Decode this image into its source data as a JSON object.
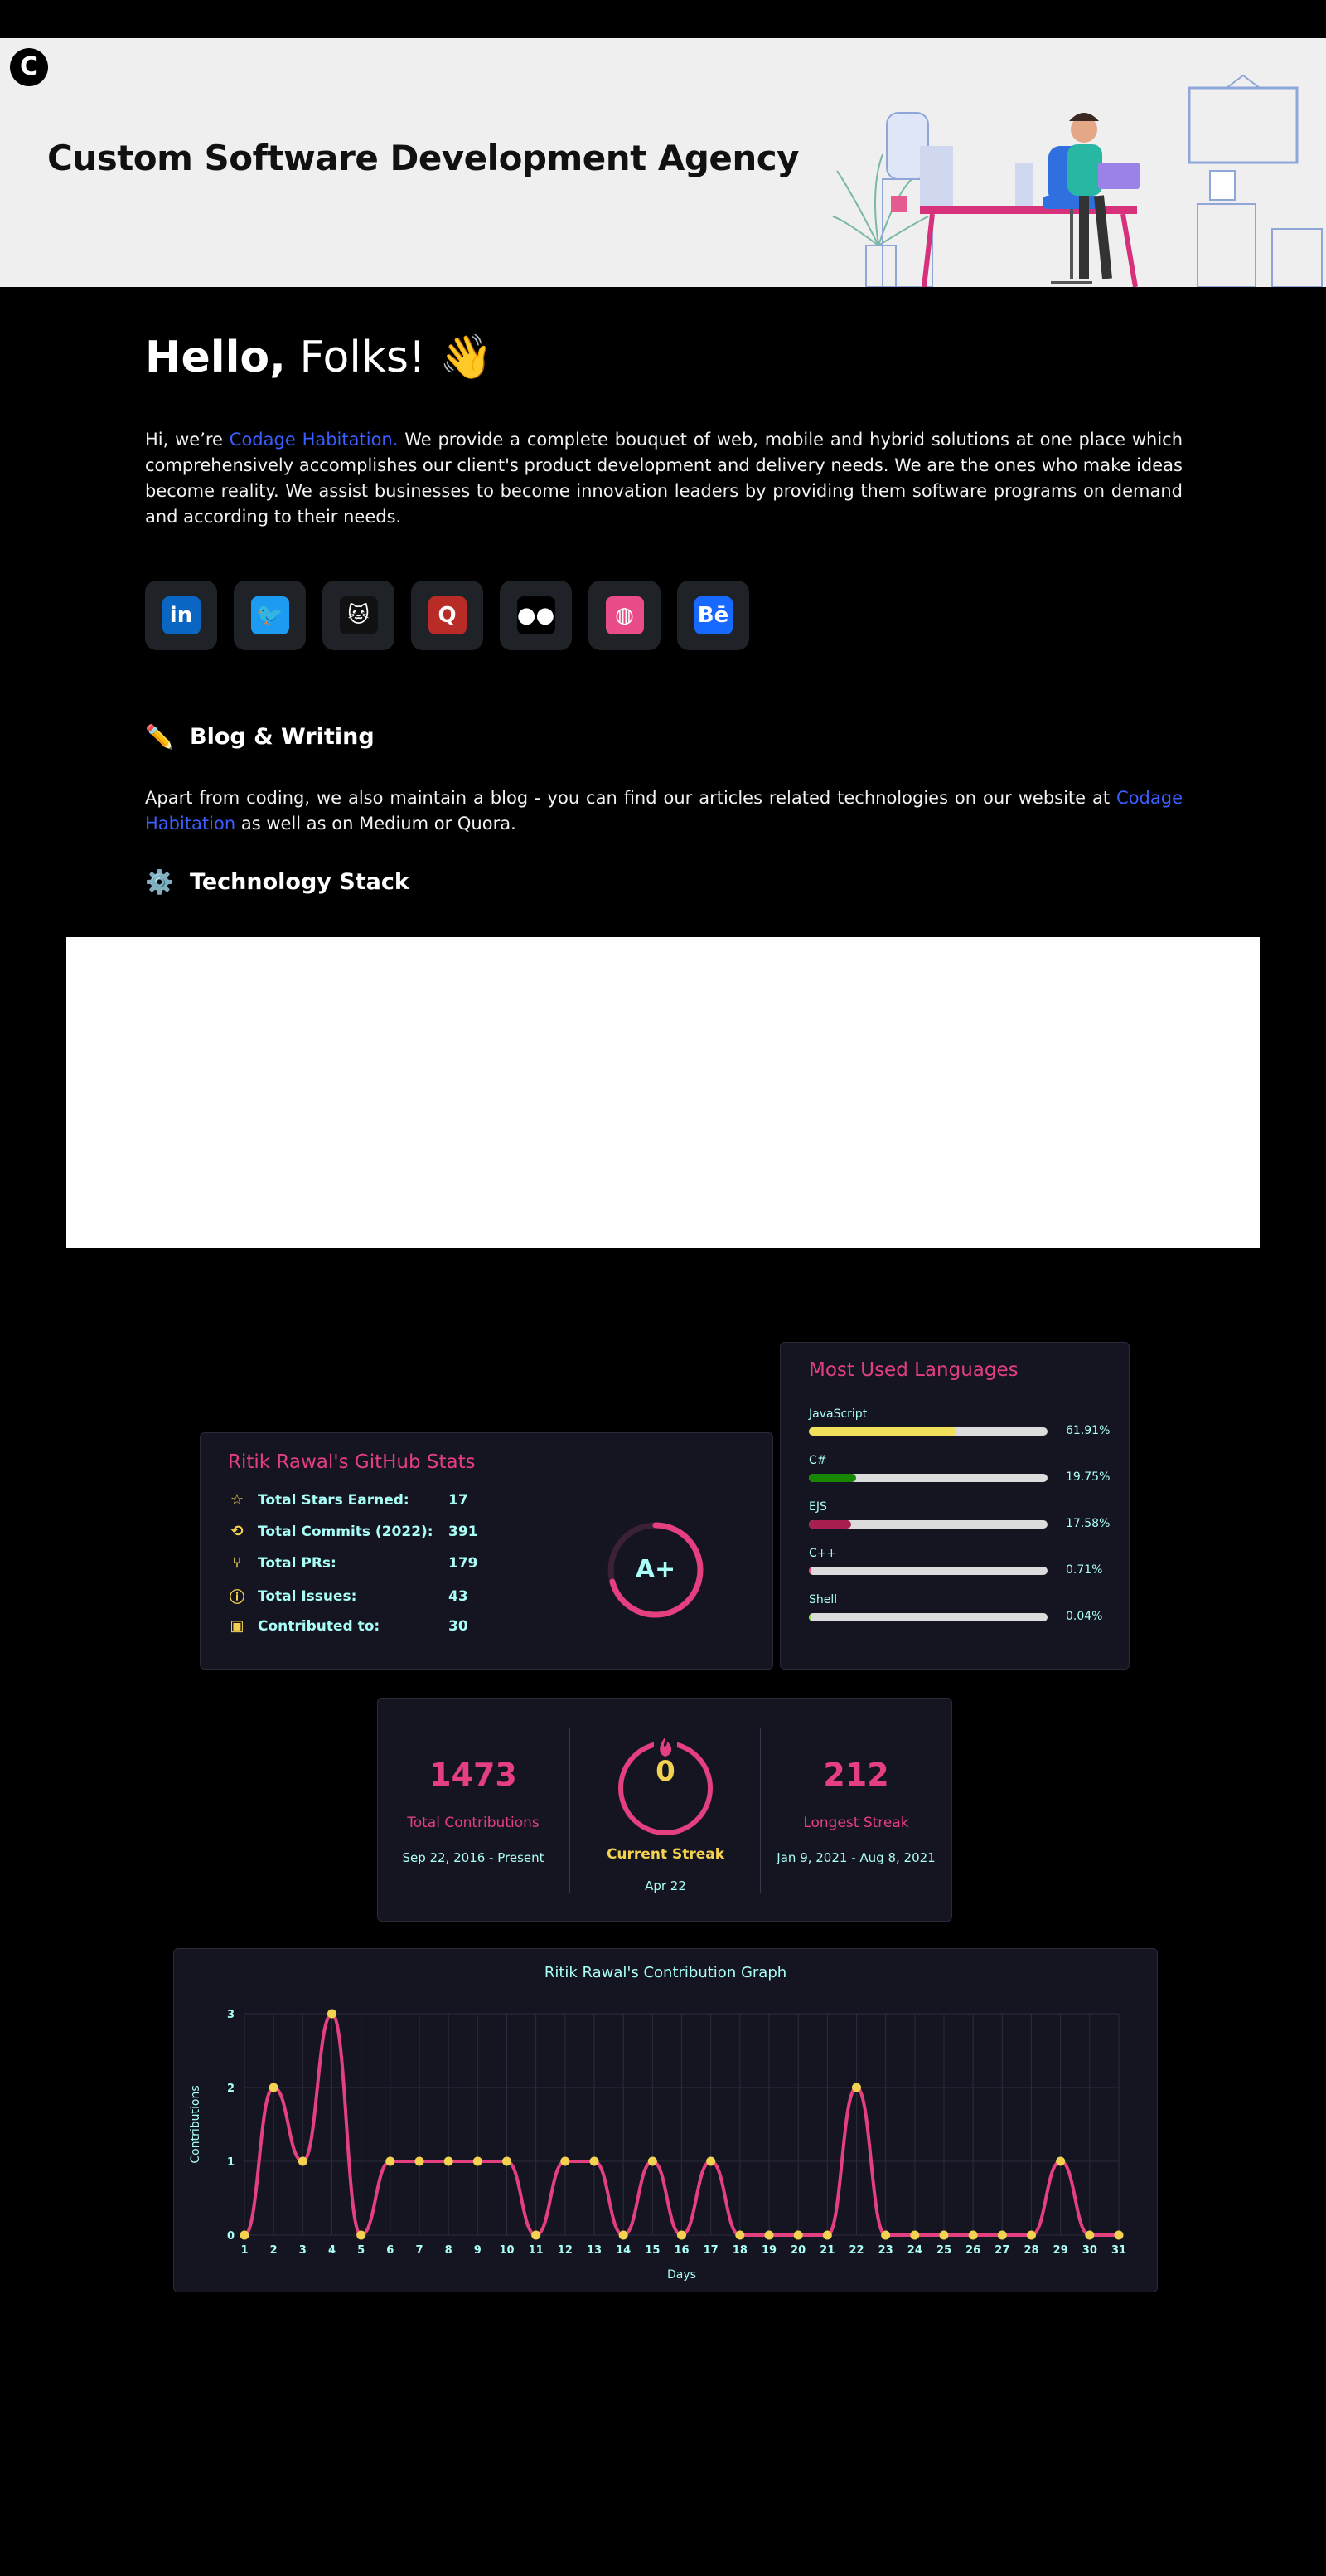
{
  "banner": {
    "logo_glyph": "C",
    "title": "Custom Software Development Agency"
  },
  "intro": {
    "hello_bold": "Hello,",
    "hello_rest": " Folks! 👋",
    "text_before": "Hi, we’re ",
    "company_link": "Codage Habitation.",
    "text_after": " We provide a complete bouquet of web, mobile and hybrid solutions at one place which comprehensively accomplishes our client's product development and delivery needs. We are the ones who make ideas become reality. We assist businesses to become innovation leaders by providing them software programs on demand and according to their needs."
  },
  "socials": [
    {
      "name": "linkedin-icon",
      "glyph": "in",
      "color": "#0a66c2"
    },
    {
      "name": "twitter-icon",
      "glyph": "🐦",
      "color": "#1d9bf0"
    },
    {
      "name": "github-icon",
      "glyph": "🐱",
      "color": "#111111"
    },
    {
      "name": "quora-icon",
      "glyph": "Q",
      "color": "#b92b27"
    },
    {
      "name": "medium-icon",
      "glyph": "●●",
      "color": "#000000"
    },
    {
      "name": "dribbble-icon",
      "glyph": "◍",
      "color": "#ea4c89"
    },
    {
      "name": "behance-icon",
      "glyph": "Bē",
      "color": "#1769ff"
    }
  ],
  "blog": {
    "icon": "✏️",
    "heading": "Blog & Writing",
    "text_before": "Apart from coding, we also maintain a blog - you can find our articles related technologies on our website at ",
    "link": "Codage Habitation",
    "text_after": " as well as on Medium or Quora."
  },
  "tech": {
    "icon": "⚙️",
    "heading": "Technology Stack"
  },
  "github_stats": {
    "title": "Ritik Rawal's GitHub Stats",
    "grade": "A+",
    "rows": [
      {
        "icon": "☆",
        "label": "Total Stars Earned:",
        "value": "17"
      },
      {
        "icon": "⟲",
        "label": "Total Commits (2022):",
        "value": "391"
      },
      {
        "icon": "⑂",
        "label": "Total PRs:",
        "value": "179"
      },
      {
        "icon": "ⓘ",
        "label": "Total Issues:",
        "value": "43"
      },
      {
        "icon": "▣",
        "label": "Contributed to:",
        "value": "30"
      }
    ]
  },
  "languages": {
    "title": "Most Used Languages",
    "items": [
      {
        "name": "JavaScript",
        "percent": "61.91%",
        "fraction": 0.6191,
        "color": "#f1e05a"
      },
      {
        "name": "C#",
        "percent": "19.75%",
        "fraction": 0.1975,
        "color": "#178600"
      },
      {
        "name": "EJS",
        "percent": "17.58%",
        "fraction": 0.1758,
        "color": "#a91e50"
      },
      {
        "name": "C++",
        "percent": "0.71%",
        "fraction": 0.0071,
        "color": "#f34b7d"
      },
      {
        "name": "Shell",
        "percent": "0.04%",
        "fraction": 0.0004,
        "color": "#89e051"
      }
    ]
  },
  "streak": {
    "total": "1473",
    "total_label": "Total Contributions",
    "total_range": "Sep 22, 2016 - Present",
    "current": "0",
    "current_label": "Current Streak",
    "current_date": "Apr 22",
    "longest": "212",
    "longest_label": "Longest Streak",
    "longest_range": "Jan 9, 2021 - Aug 8, 2021"
  },
  "chart_data": {
    "type": "line",
    "title": "Ritik Rawal's Contribution Graph",
    "xlabel": "Days",
    "ylabel": "Contributions",
    "x": [
      1,
      2,
      3,
      4,
      5,
      6,
      7,
      8,
      9,
      10,
      11,
      12,
      13,
      14,
      15,
      16,
      17,
      18,
      19,
      20,
      21,
      22,
      23,
      24,
      25,
      26,
      27,
      28,
      29,
      30,
      31
    ],
    "series": [
      {
        "values": [
          0,
          2,
          1,
          3,
          0,
          1,
          1,
          1,
          1,
          1,
          0,
          1,
          1,
          0,
          1,
          0,
          1,
          0,
          0,
          0,
          0,
          2,
          0,
          0,
          0,
          0,
          0,
          0,
          1,
          0,
          0
        ]
      }
    ],
    "ylim": [
      0,
      3
    ],
    "yticks": [
      0,
      1,
      2,
      3
    ],
    "line_color": "#e43f7f",
    "point_color": "#f3d250",
    "grid": true
  }
}
